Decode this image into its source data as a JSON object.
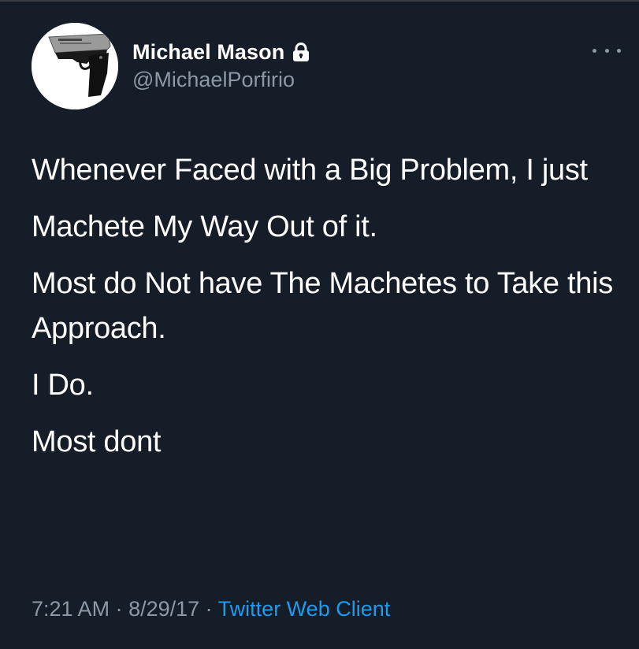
{
  "user": {
    "display_name": "Michael Mason",
    "handle": "@MichaelPorfirio",
    "verified_icon": "lock-icon",
    "avatar_icon": "pistol-image"
  },
  "tweet": {
    "paragraphs": [
      "Whenever Faced with a Big Problem, I just",
      "Machete My Way Out of it.",
      "Most do Not have The Machetes to Take this Approach.",
      "I Do.",
      "Most dont"
    ]
  },
  "meta": {
    "time": "7:21 AM",
    "sep1": " · ",
    "date": "8/29/17",
    "sep2": " · ",
    "source": "Twitter Web Client"
  },
  "colors": {
    "background": "#151d28",
    "text": "#ffffff",
    "secondary": "#8b98a5",
    "link": "#1d9bf0"
  }
}
